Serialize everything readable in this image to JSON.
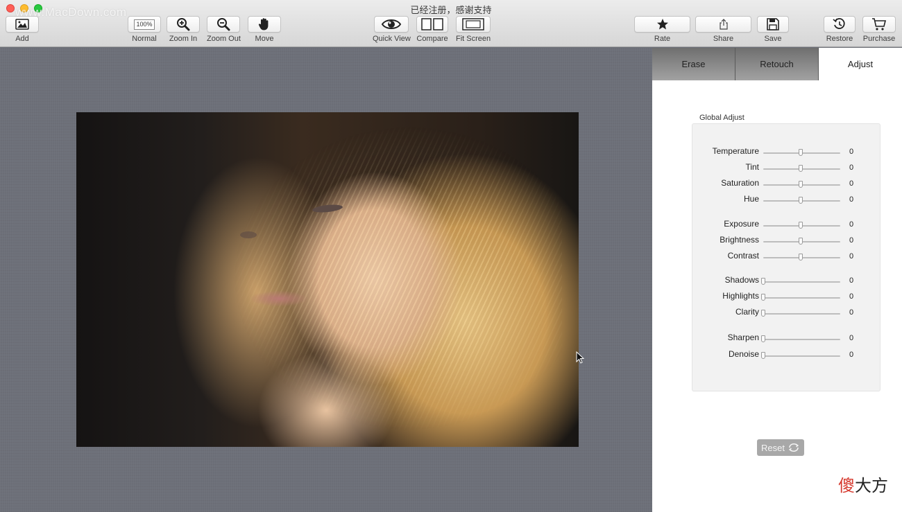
{
  "window": {
    "title": "已经注册，感谢支持",
    "watermark": "www.MacDown.com"
  },
  "toolbar": {
    "add": "Add",
    "normal": "Normal",
    "normal_zoom": "100%",
    "zoom_in": "Zoom In",
    "zoom_out": "Zoom Out",
    "move": "Move",
    "quick_view": "Quick View",
    "compare": "Compare",
    "fit_screen": "Fit Screen",
    "rate": "Rate",
    "share": "Share",
    "save": "Save",
    "restore": "Restore",
    "purchase": "Purchase"
  },
  "tabs": {
    "erase": "Erase",
    "retouch": "Retouch",
    "adjust": "Adjust",
    "active": "Adjust"
  },
  "adjust": {
    "group_label": "Global Adjust",
    "sliders": [
      {
        "name": "Temperature",
        "value": "0",
        "position": 0.5
      },
      {
        "name": "Tint",
        "value": "0",
        "position": 0.5
      },
      {
        "name": "Saturation",
        "value": "0",
        "position": 0.5
      },
      {
        "name": "Hue",
        "value": "0",
        "position": 0.5
      },
      {
        "name": "Exposure",
        "value": "0",
        "position": 0.5
      },
      {
        "name": "Brightness",
        "value": "0",
        "position": 0.5
      },
      {
        "name": "Contrast",
        "value": "0",
        "position": 0.5
      },
      {
        "name": "Shadows",
        "value": "0",
        "position": 0.0
      },
      {
        "name": "Highlights",
        "value": "0",
        "position": 0.0
      },
      {
        "name": "Clarity",
        "value": "0",
        "position": 0.0
      },
      {
        "name": "Sharpen",
        "value": "0",
        "position": 0.0
      },
      {
        "name": "Denoise",
        "value": "0",
        "position": 0.0
      }
    ],
    "reset_label": "Reset"
  },
  "brand": {
    "part1": "傻",
    "part2": "大方"
  },
  "colors": {
    "canvas_bg": "#6d7079",
    "tab_inactive": "#8a8a8a",
    "close": "#fe5f57",
    "minimize": "#febc2e",
    "maximize": "#28c840",
    "brand_red": "#d63a2f"
  }
}
